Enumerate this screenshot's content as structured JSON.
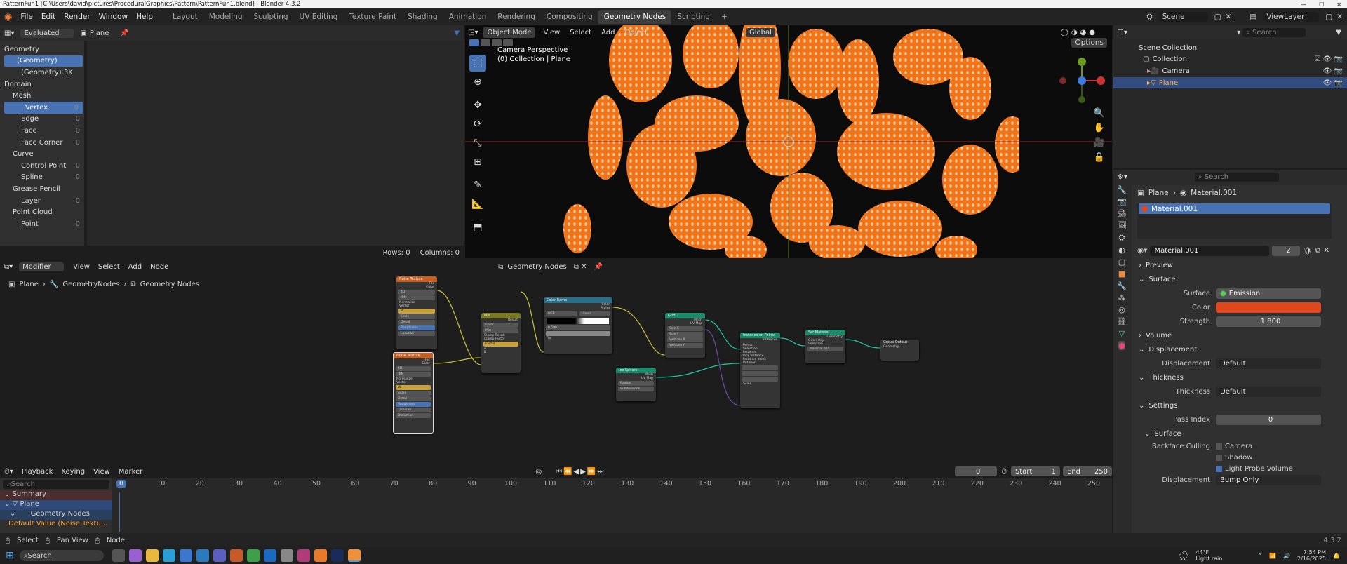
{
  "title": {
    "text": "PatternFun1 [C:\\Users\\david\\pictures\\ProceduralGraphics\\Pattern\\PatternFun1.blend] - Blender 4.3.2"
  },
  "menu": [
    "File",
    "Edit",
    "Render",
    "Window",
    "Help"
  ],
  "workspaces": [
    "Layout",
    "Modeling",
    "Sculpting",
    "UV Editing",
    "Texture Paint",
    "Shading",
    "Animation",
    "Rendering",
    "Compositing",
    "Geometry Nodes",
    "Scripting"
  ],
  "scene": {
    "label": "Scene",
    "view_layer": "ViewLayer"
  },
  "spreadsheet": {
    "mode": "Evaluated",
    "object": "Plane",
    "tree": [
      {
        "label": "Geometry",
        "indent": 0,
        "count": "",
        "sel": false
      },
      {
        "label": "(Geometry)",
        "indent": 1,
        "count": "",
        "sel": true
      },
      {
        "label": "(Geometry).3K",
        "indent": 2,
        "count": "",
        "sel": false
      },
      {
        "label": "Domain",
        "indent": 0,
        "count": "",
        "sel": false
      },
      {
        "label": "Mesh",
        "indent": 1,
        "count": "",
        "sel": false
      },
      {
        "label": "Vertex",
        "indent": 2,
        "count": "0",
        "sel": true
      },
      {
        "label": "Edge",
        "indent": 2,
        "count": "0",
        "sel": false
      },
      {
        "label": "Face",
        "indent": 2,
        "count": "0",
        "sel": false
      },
      {
        "label": "Face Corner",
        "indent": 2,
        "count": "0",
        "sel": false
      },
      {
        "label": "Curve",
        "indent": 1,
        "count": "",
        "sel": false
      },
      {
        "label": "Control Point",
        "indent": 2,
        "count": "0",
        "sel": false
      },
      {
        "label": "Spline",
        "indent": 2,
        "count": "0",
        "sel": false
      },
      {
        "label": "Grease Pencil",
        "indent": 1,
        "count": "",
        "sel": false
      },
      {
        "label": "Layer",
        "indent": 2,
        "count": "0",
        "sel": false
      },
      {
        "label": "Point Cloud",
        "indent": 1,
        "count": "",
        "sel": false
      },
      {
        "label": "Point",
        "indent": 2,
        "count": "0",
        "sel": false
      }
    ],
    "rows": "Rows: 0",
    "columns": "Columns: 0"
  },
  "viewport": {
    "mode": "Object Mode",
    "menus": [
      "View",
      "Select",
      "Add",
      "Object"
    ],
    "transform": "Global",
    "options": "Options",
    "overlay1": "Camera Perspective",
    "overlay2": "(0) Collection | Plane"
  },
  "outliner": {
    "search": "Search",
    "items": [
      "Scene Collection",
      "Collection",
      "Camera",
      "Plane"
    ]
  },
  "properties": {
    "search": "Search",
    "breadcrumb_obj": "Plane",
    "breadcrumb_mat": "Material.001",
    "slot": "Material.001",
    "mat_name": "Material.001",
    "users": "2",
    "sections": {
      "preview": "Preview",
      "surface": "Surface",
      "volume": "Volume",
      "displacement": "Displacement",
      "thickness": "Thickness",
      "settings": "Settings",
      "surface2": "Surface"
    },
    "surface_label": "Surface",
    "surface_value": "Emission",
    "color_label": "Color",
    "color_hex": "#e0471c",
    "strength_label": "Strength",
    "strength_value": "1.800",
    "disp_label": "Displacement",
    "disp_value": "Default",
    "thick_label": "Thickness",
    "thick_value": "Default",
    "pass_label": "Pass Index",
    "pass_value": "0",
    "bc_label": "Backface Culling",
    "camera": "Camera",
    "shadow": "Shadow",
    "lpv": "Light Probe Volume",
    "disp2_label": "Displacement",
    "disp2_value": "Bump Only"
  },
  "node_editor": {
    "modifier": "Modifier",
    "menus": [
      "View",
      "Select",
      "Add",
      "Node"
    ],
    "tree": "Geometry Nodes",
    "breadcrumb": [
      "Plane",
      "GeometryNodes",
      "Geometry Nodes"
    ],
    "nodes": {
      "noise1": "Noise Texture",
      "noise2": "Noise Texture",
      "mix": "Mix",
      "ramp": "Color Ramp",
      "grid": "Grid",
      "ico": "Ico Sphere",
      "inst": "Instance on Points",
      "setmat": "Set Material",
      "out": "Group Output"
    },
    "fields": {
      "ramp_mode": "RGB",
      "ramp_interp": "Linear",
      "ramp_pos": "0.590",
      "setmat_mat": "Material.001",
      "clamp_factor": "Clamp Factor",
      "clamp_result": "Clamp Result",
      "factor": "Factor",
      "fac": "Fac",
      "color": "Color",
      "alpha": "Alpha",
      "result": "Result",
      "mesh": "Mesh",
      "uvmap": "UV Map",
      "points": "Points",
      "selection": "Selection",
      "instance": "Instance",
      "instances": "Instances",
      "pick": "Pick Instance",
      "inst_index": "Instance Index",
      "rotation": "Rotation",
      "scale": "Scale",
      "geometry": "Geometry",
      "material": "Material",
      "normalize": "Normalize",
      "vector": "Vector",
      "w": "W",
      "detail": "Detail",
      "roughness": "Roughness",
      "lacunarity": "Lacunari",
      "distortion": "Distortion",
      "dims": "4D",
      "fbm": "fBM",
      "radius": "Radius",
      "subdiv": "Subdivisions",
      "sizex": "Size X",
      "sizey": "Size Y",
      "vertx": "Vertices X",
      "verty": "Vertices Y",
      "a": "A",
      "b": "B",
      "mix_t": "Color",
      "mix_b": "Mix"
    }
  },
  "timeline": {
    "menus": [
      "Playback",
      "Keying",
      "View",
      "Marker"
    ],
    "frame": "0",
    "start_label": "Start",
    "start": "1",
    "end_label": "End",
    "end": "250",
    "ticks": [
      "0",
      "10",
      "20",
      "30",
      "40",
      "50",
      "60",
      "70",
      "80",
      "90",
      "100",
      "110",
      "120",
      "130",
      "140",
      "150",
      "160",
      "170",
      "180",
      "190",
      "200",
      "210",
      "220",
      "230",
      "240",
      "250"
    ],
    "search": "Search",
    "channels": [
      "Summary",
      "Plane",
      "Geometry Nodes",
      "Default Value (Noise Textu..."
    ]
  },
  "statusbar": {
    "select": "Select",
    "pan": "Pan View",
    "node": "Node",
    "version": "4.3.2"
  },
  "taskbar": {
    "search": "Search",
    "weather": "44°F",
    "weather2": "Light rain",
    "time": "7:54 PM",
    "date": "2/16/2025"
  }
}
